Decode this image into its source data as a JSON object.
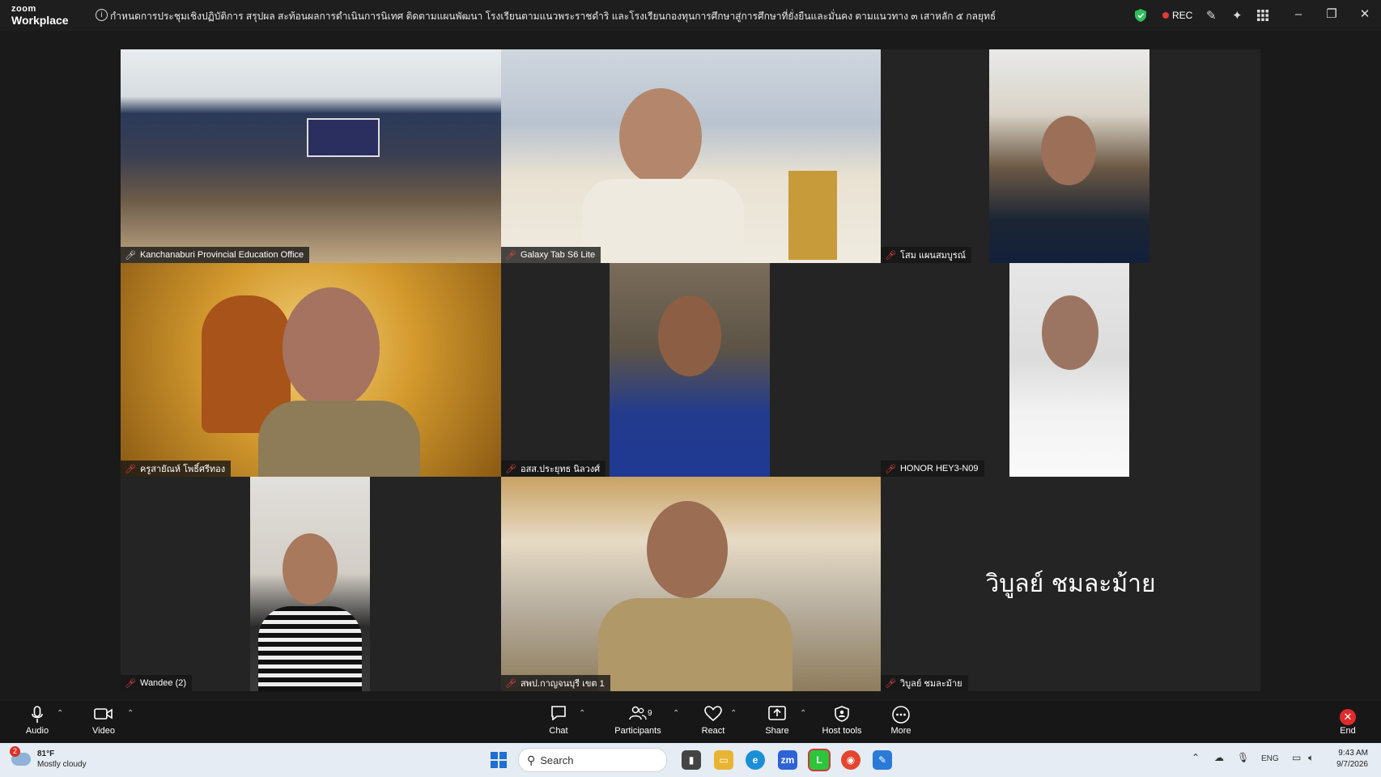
{
  "titlebar": {
    "logo_top": "zoom",
    "logo_bottom": "Workplace",
    "meeting_title": "กำหนดการประชุมเชิงปฏิบัติการ สรุปผล สะท้อนผลการดำเนินการนิเทศ ติดตามแผนพัฒนา โรงเรียนตามแนวพระราชดำริ และโรงเรียนกองทุนการศึกษาสู่การศึกษาที่ยั่งยืนและมั่นคง ตามแนวทาง ๓ เสาหลัก ๕ กลยุทธ์",
    "rec_label": "REC"
  },
  "participants": [
    {
      "name": "Kanchanaburi Provincial Education Office",
      "muted": false,
      "active": true
    },
    {
      "name": "Galaxy Tab S6 Lite",
      "muted": true
    },
    {
      "name": "โสม แผนสมบูรณ์",
      "muted": true
    },
    {
      "name": "ครูสายัณห์ โพธิ์ศรีทอง",
      "muted": true
    },
    {
      "name": "อสส.ประยุทธ นิลวงศ์",
      "muted": true
    },
    {
      "name": "HONOR HEY3-N09",
      "muted": true
    },
    {
      "name": "Wandee (2)",
      "muted": true
    },
    {
      "name": "สพป.กาญจนบุรี เขต 1",
      "muted": true
    },
    {
      "name": "วิบูลย์ ชมละม้าย",
      "muted": true,
      "display_name": "วิบูลย์  ชมละม้าย"
    }
  ],
  "toolbar": {
    "audio": "Audio",
    "video": "Video",
    "chat": "Chat",
    "participants": "Participants",
    "participants_count": "9",
    "react": "React",
    "share": "Share",
    "host_tools": "Host tools",
    "more": "More",
    "end": "End"
  },
  "taskbar": {
    "weather_badge": "2",
    "temperature": "81°F",
    "condition": "Mostly cloudy",
    "search_placeholder": "Search",
    "language": "ENG",
    "time": "9:43 AM",
    "date": "9/7/2026"
  },
  "colors": {
    "active_speaker": "#2fd36b",
    "muted_icon": "#e54848",
    "end_button": "#e02b2b"
  }
}
